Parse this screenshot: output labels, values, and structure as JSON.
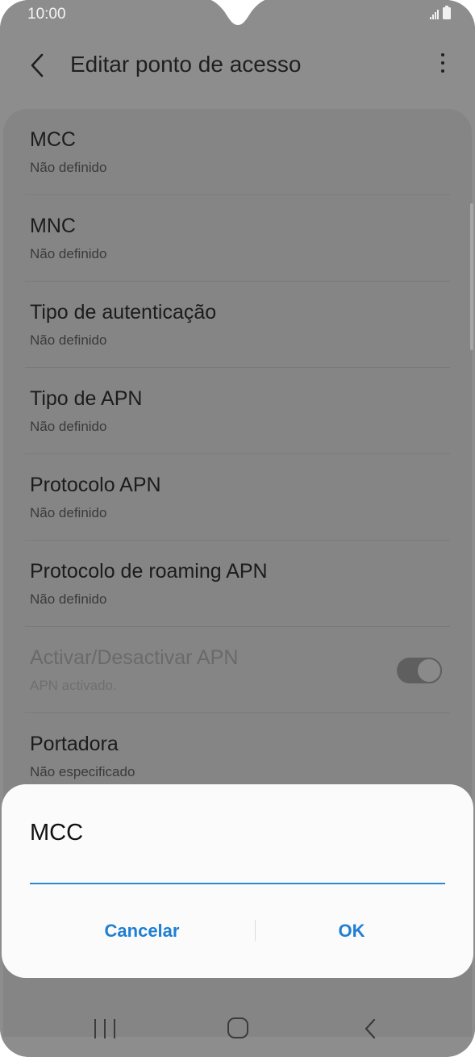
{
  "status_bar": {
    "time": "10:00"
  },
  "app_bar": {
    "title": "Editar ponto de acesso"
  },
  "settings_items": [
    {
      "title": "MCC",
      "subtitle": "Não definido"
    },
    {
      "title": "MNC",
      "subtitle": "Não definido"
    },
    {
      "title": "Tipo de autenticação",
      "subtitle": "Não definido"
    },
    {
      "title": "Tipo de APN",
      "subtitle": "Não definido"
    },
    {
      "title": "Protocolo APN",
      "subtitle": "Não definido"
    },
    {
      "title": "Protocolo de roaming APN",
      "subtitle": "Não definido"
    },
    {
      "title": "Activar/Desactivar APN",
      "subtitle": "APN activado.",
      "toggle_on": true,
      "enabled": false
    },
    {
      "title": "Portadora",
      "subtitle": "Não especificado"
    }
  ],
  "dialog": {
    "title": "MCC",
    "input_value": "",
    "cancel_label": "Cancelar",
    "ok_label": "OK"
  },
  "colors": {
    "accent": "#1e7fd4",
    "dim_background": "#8d8d8d",
    "dialog_background": "#fbfbfb"
  },
  "icons": {
    "back": "chevron-left-icon",
    "more": "more-vertical-icon",
    "nav_recents": "recents-icon",
    "nav_home": "home-icon",
    "nav_back": "back-icon"
  }
}
